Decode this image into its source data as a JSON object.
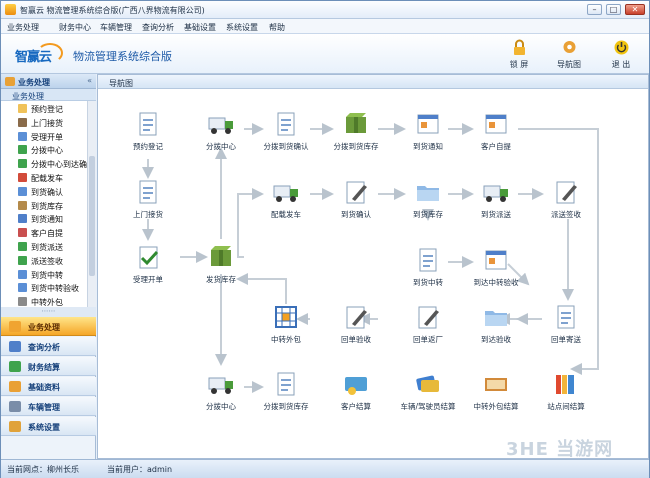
{
  "window": {
    "title": "智赢云 物流管理系统综合版(广西八界物流有限公司)"
  },
  "menu": [
    "业务处理",
    "财务中心",
    "车辆管理",
    "查询分析",
    "基础设置",
    "系统设置",
    "帮助"
  ],
  "header": {
    "logo_text": "智赢云",
    "app_title": "物流管理系统综合版",
    "toolbar": [
      {
        "label": "锁 屏",
        "icon": "lock-icon"
      },
      {
        "label": "导航图",
        "icon": "gear-icon"
      },
      {
        "label": "退 出",
        "icon": "power-icon"
      }
    ]
  },
  "sidebar": {
    "header": "业务处理",
    "collapse": "«",
    "section": "业务处理",
    "items": [
      "预约登记",
      "上门接货",
      "受理开单",
      "分拨中心",
      "分拨中心到达确认",
      "配载发车",
      "到货确认",
      "到货库存",
      "到货通知",
      "客户自提",
      "到货派送",
      "派送签收",
      "到货中转",
      "到货中转验收",
      "中转外包"
    ],
    "dots": "⋯⋯",
    "modules": [
      {
        "label": "业务处理",
        "active": true
      },
      {
        "label": "查询分析"
      },
      {
        "label": "财务结算"
      },
      {
        "label": "基础资料"
      },
      {
        "label": "车辆管理"
      },
      {
        "label": "系统设置"
      }
    ]
  },
  "main": {
    "nav_title": "导航图"
  },
  "flow": {
    "nodes": [
      "预约登记",
      "上门接货",
      "受理开单",
      "分拨中心",
      "发货库存",
      "分拨到货确认",
      "分拨到货库存",
      "到货通知",
      "客户自提",
      "配载发车",
      "到货确认",
      "到货库存",
      "到货派送",
      "派送签收",
      "到货中转",
      "到达中转验收",
      "中转外包",
      "回单验收",
      "回单返厂",
      "到达验收",
      "回单寄送",
      "分拨中心",
      "分拨到货库存",
      "客户结算",
      "车辆/驾驶员结算",
      "中转外包结算",
      "站点间结算"
    ]
  },
  "status": {
    "site": "当前网点：柳州长乐",
    "user": "当前用户：admin"
  },
  "watermark": "3HE 当游网"
}
